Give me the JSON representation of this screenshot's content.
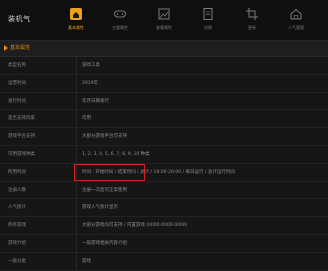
{
  "app": {
    "logo_text": "装机气"
  },
  "nav": {
    "items": [
      {
        "label": "基本属性",
        "icon": "home-icon",
        "active": true
      },
      {
        "label": "主题属性",
        "icon": "gamepad-icon",
        "active": false
      },
      {
        "label": "查看属性",
        "icon": "image-icon",
        "active": false
      },
      {
        "label": "详情",
        "icon": "document-icon",
        "active": false
      },
      {
        "label": "更新",
        "icon": "crop-icon",
        "active": false
      },
      {
        "label": "人气管理",
        "icon": "house-icon",
        "active": false
      }
    ]
  },
  "section": {
    "title": "基本属性"
  },
  "rows": [
    {
      "label": "类型名称",
      "value": "游戏工具"
    },
    {
      "label": "运营时间",
      "value": "2019年"
    },
    {
      "label": "发行时间",
      "value": "年月日期发行"
    },
    {
      "label": "是否支持玩家",
      "value": "可用"
    },
    {
      "label": "游戏平台支持",
      "value": "大部分游戏平台可支持"
    },
    {
      "label": "可用游戏种类",
      "value": "1, 2, 3, 4, 5, 6, 7, 8, 9, 10 种类"
    },
    {
      "label": "所用时间",
      "value": "时间 : 开始时间 / 结束时间 / 总计 / 19:00-20:00 / 每日运行 / 总计运行时间"
    },
    {
      "label": "注册人数",
      "value": "注册一次后可正常使用"
    },
    {
      "label": "人气统计",
      "value": "游戏人气统计显示"
    },
    {
      "label": "所有游戏",
      "value": "大部分游戏均可支持 / 内置游戏 (0000-0000-0000)"
    },
    {
      "label": "游戏介绍",
      "value": "一般游戏相关内容介绍"
    },
    {
      "label": "一级分类",
      "value": "游戏"
    }
  ],
  "highlight_row_index": 7
}
